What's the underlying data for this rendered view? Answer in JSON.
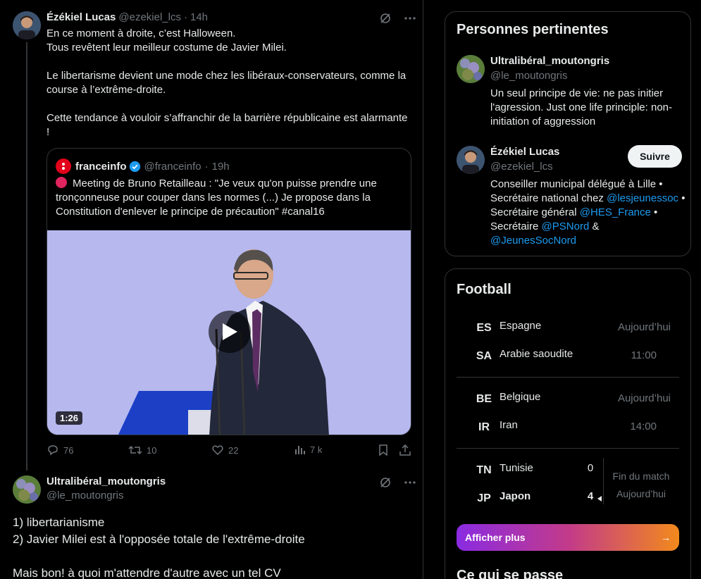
{
  "tweet1": {
    "name": "Ézékiel Lucas",
    "handle": "@ezekiel_lcs",
    "time": "14h",
    "text": "En ce moment à droite, c’est Halloween.\nTous revêtent leur meilleur costume de Javier Milei.\n\nLe libertarisme devient une mode chez les libéraux-conservateurs, comme la course à l’extrême-droite.\n\nCette tendance à vouloir s’affranchir de la barrière républicaine est alarmante !",
    "quote": {
      "name": "franceinfo",
      "handle": "@franceinfo",
      "time": "19h",
      "text": "Meeting de Bruno Retailleau : \"Je veux qu'on puisse prendre une tronçonneuse pour couper dans les normes (...) Je propose dans la Constitution d'enlever le principe de précaution\" #canal16",
      "duration": "1:26"
    },
    "actions": {
      "replies": "76",
      "reposts": "10",
      "likes": "22",
      "views": "7 k"
    }
  },
  "tweet2": {
    "name": "Ultralibéral_moutongris",
    "handle": "@le_moutongris",
    "text": "1) libertarianisme\n2) Javier Milei est à l'opposée totale de l'extrême-droite\n\nMais bon! à quoi m'attendre d'autre avec un tel CV"
  },
  "relevant": {
    "title": "Personnes pertinentes",
    "people": [
      {
        "name": "Ultralibéral_moutongris",
        "handle": "@le_moutongris",
        "bio": "Un seul principe de vie: ne pas initier l'agression. Just one life principle: non-initiation of aggression"
      },
      {
        "name": "Ézékiel Lucas",
        "handle": "@ezekiel_lcs",
        "follow_label": "Suivre",
        "bio_parts": [
          "Conseiller municipal délégué à Lille • Secrétaire national chez ",
          "@lesjeunessoc",
          " • Secrétaire général ",
          "@HES_France",
          " • Secrétaire ",
          "@PSNord",
          " & ",
          "@JeunesSocNord"
        ]
      }
    ]
  },
  "football": {
    "title": "Football",
    "matches": [
      {
        "home_code": "ES",
        "home": "Espagne",
        "away_code": "SA",
        "away": "Arabie saoudite",
        "status_top": "Aujourd’hui",
        "status_bottom": "11:00"
      },
      {
        "home_code": "BE",
        "home": "Belgique",
        "away_code": "IR",
        "away": "Iran",
        "status_top": "Aujourd’hui",
        "status_bottom": "14:00"
      },
      {
        "home_code": "TN",
        "home": "Tunisie",
        "home_score": "0",
        "away_code": "JP",
        "away": "Japon",
        "away_score": "4",
        "status_top": "Fin du match",
        "status_bottom": "Aujourd’hui"
      }
    ],
    "show_more_label": "Afficher plus",
    "arrow_icon": "→"
  },
  "next_section_title": "Ce qui se passe",
  "colors": {
    "accent": "#1d9bf0",
    "muted": "#71767b",
    "border": "#2f3336",
    "brand_red": "#e2001a"
  }
}
